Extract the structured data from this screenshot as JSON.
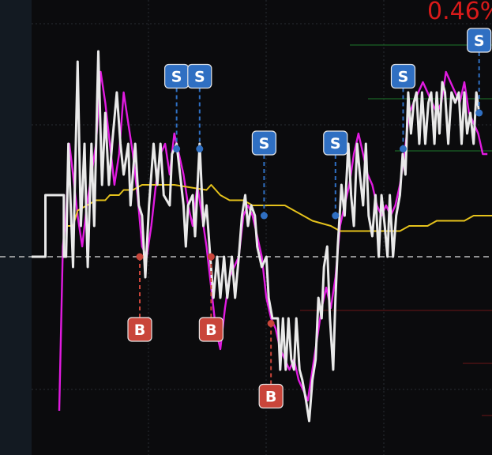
{
  "colors": {
    "background": "#0b0b0d",
    "left_panel": "#131a22",
    "grid": "#2a2d33",
    "price_line": "#e9e9e9",
    "magenta_line": "#e11be0",
    "avg_line": "#e5c21c",
    "baseline": "#bdbdbd",
    "buy": "#c9453a",
    "sell": "#2f6fc2",
    "percent_text": "#d91a1a"
  },
  "header": {
    "percent_label": "0.46%"
  },
  "chart_data": {
    "type": "line",
    "title": "",
    "xlabel": "",
    "ylabel": "",
    "x_range": [
      0,
      100
    ],
    "y_range": [
      0,
      100
    ],
    "baseline_y": 50,
    "series": [
      {
        "role": "price",
        "points": [
          [
            0,
            50
          ],
          [
            3,
            50
          ],
          [
            3,
            62
          ],
          [
            7,
            62
          ],
          [
            7,
            50
          ],
          [
            7.5,
            50
          ],
          [
            8,
            72
          ],
          [
            9,
            48
          ],
          [
            10,
            88
          ],
          [
            10.7,
            56
          ],
          [
            11.5,
            72
          ],
          [
            12.2,
            48
          ],
          [
            13,
            72
          ],
          [
            13.6,
            56
          ],
          [
            14.5,
            90
          ],
          [
            15.3,
            64
          ],
          [
            16,
            78
          ],
          [
            16.8,
            64
          ],
          [
            17.5,
            72
          ],
          [
            18.5,
            82
          ],
          [
            19.3,
            72
          ],
          [
            20,
            66
          ],
          [
            21,
            72
          ],
          [
            21.5,
            60
          ],
          [
            22.5,
            72
          ],
          [
            23.3,
            60
          ],
          [
            24,
            58
          ],
          [
            24.7,
            46
          ],
          [
            25.5,
            60
          ],
          [
            26.5,
            72
          ],
          [
            27.3,
            64
          ],
          [
            28,
            72
          ],
          [
            28.7,
            62
          ],
          [
            30,
            60
          ],
          [
            30.5,
            70
          ],
          [
            31.5,
            72
          ],
          [
            32,
            68
          ],
          [
            33,
            60
          ],
          [
            33.5,
            52
          ],
          [
            34,
            60
          ],
          [
            35,
            62
          ],
          [
            35.5,
            54
          ],
          [
            36.5,
            72
          ],
          [
            37.3,
            56
          ],
          [
            38,
            60
          ],
          [
            38.8,
            50
          ],
          [
            39.5,
            42
          ],
          [
            40.3,
            50
          ],
          [
            41,
            42
          ],
          [
            41.8,
            50
          ],
          [
            42.5,
            42
          ],
          [
            43.5,
            50
          ],
          [
            44.2,
            42
          ],
          [
            45,
            50
          ],
          [
            45.7,
            58
          ],
          [
            46.4,
            62
          ],
          [
            47,
            56
          ],
          [
            47.7,
            60
          ],
          [
            48.5,
            58
          ],
          [
            49,
            52
          ],
          [
            50,
            48
          ],
          [
            51,
            50
          ],
          [
            51.5,
            42
          ],
          [
            52.3,
            38
          ],
          [
            53.5,
            38
          ],
          [
            54,
            28
          ],
          [
            54.6,
            38
          ],
          [
            55.2,
            28
          ],
          [
            55.8,
            38
          ],
          [
            56.4,
            30
          ],
          [
            57,
            28
          ],
          [
            57.5,
            38
          ],
          [
            58.2,
            28
          ],
          [
            58.8,
            26
          ],
          [
            59.6,
            22
          ],
          [
            60.3,
            18
          ],
          [
            61,
            26
          ],
          [
            61.7,
            30
          ],
          [
            62.3,
            42
          ],
          [
            63,
            38
          ],
          [
            63.5,
            48
          ],
          [
            64.2,
            52
          ],
          [
            64.8,
            38
          ],
          [
            65.5,
            28
          ],
          [
            66,
            42
          ],
          [
            66.5,
            52
          ],
          [
            67.3,
            64
          ],
          [
            68,
            58
          ],
          [
            68.8,
            72
          ],
          [
            69.4,
            62
          ],
          [
            70,
            56
          ],
          [
            70.7,
            72
          ],
          [
            71.3,
            66
          ],
          [
            72,
            60
          ],
          [
            72.6,
            72
          ],
          [
            73.2,
            58
          ],
          [
            74,
            54
          ],
          [
            74.7,
            62
          ],
          [
            75.4,
            50
          ],
          [
            76,
            62
          ],
          [
            76.7,
            56
          ],
          [
            77.3,
            50
          ],
          [
            77.8,
            62
          ],
          [
            78.5,
            50
          ],
          [
            79.2,
            58
          ],
          [
            80,
            62
          ],
          [
            80.6,
            70
          ],
          [
            81.2,
            66
          ],
          [
            81.8,
            82
          ],
          [
            82.4,
            74
          ],
          [
            83,
            80
          ],
          [
            83.6,
            82
          ],
          [
            84.2,
            72
          ],
          [
            84.8,
            82
          ],
          [
            85.5,
            72
          ],
          [
            86.2,
            80
          ],
          [
            86.8,
            82
          ],
          [
            87.5,
            72
          ],
          [
            88,
            82
          ],
          [
            88.6,
            74
          ],
          [
            89.2,
            84
          ],
          [
            89.8,
            82
          ],
          [
            90.5,
            72
          ],
          [
            91.2,
            82
          ],
          [
            92,
            80
          ],
          [
            92.8,
            82
          ],
          [
            93.4,
            72
          ],
          [
            94,
            82
          ],
          [
            94.6,
            74
          ],
          [
            95.3,
            78
          ],
          [
            96,
            72
          ],
          [
            96.6,
            82
          ],
          [
            97.2,
            78
          ]
        ]
      },
      {
        "role": "magenta",
        "points": [
          [
            6,
            20
          ],
          [
            6.8,
            52
          ],
          [
            7.5,
            58
          ],
          [
            8.2,
            72
          ],
          [
            9,
            66
          ],
          [
            10,
            58
          ],
          [
            11,
            52
          ],
          [
            12,
            60
          ],
          [
            13,
            66
          ],
          [
            14,
            72
          ],
          [
            15,
            86
          ],
          [
            16,
            80
          ],
          [
            17,
            72
          ],
          [
            18,
            64
          ],
          [
            19,
            70
          ],
          [
            20,
            82
          ],
          [
            21,
            76
          ],
          [
            22,
            70
          ],
          [
            23,
            62
          ],
          [
            24,
            52
          ],
          [
            25,
            50
          ],
          [
            26,
            56
          ],
          [
            27,
            64
          ],
          [
            28,
            70
          ],
          [
            29,
            72
          ],
          [
            30,
            66
          ],
          [
            31,
            74
          ],
          [
            32,
            70
          ],
          [
            33,
            66
          ],
          [
            34,
            60
          ],
          [
            35,
            56
          ],
          [
            36,
            64
          ],
          [
            37,
            58
          ],
          [
            38,
            52
          ],
          [
            39,
            44
          ],
          [
            40,
            36
          ],
          [
            41,
            32
          ],
          [
            42,
            40
          ],
          [
            43,
            46
          ],
          [
            44,
            48
          ],
          [
            45,
            50
          ],
          [
            46,
            58
          ],
          [
            47,
            60
          ],
          [
            48,
            58
          ],
          [
            49,
            54
          ],
          [
            50,
            50
          ],
          [
            51,
            42
          ],
          [
            52,
            38
          ],
          [
            53,
            36
          ],
          [
            54,
            32
          ],
          [
            55,
            30
          ],
          [
            56,
            28
          ],
          [
            57,
            30
          ],
          [
            58,
            26
          ],
          [
            59,
            24
          ],
          [
            60,
            22
          ],
          [
            61,
            28
          ],
          [
            62,
            34
          ],
          [
            63,
            40
          ],
          [
            64,
            44
          ],
          [
            65,
            40
          ],
          [
            66,
            46
          ],
          [
            67,
            56
          ],
          [
            68,
            60
          ],
          [
            69,
            64
          ],
          [
            70,
            70
          ],
          [
            71,
            74
          ],
          [
            72,
            70
          ],
          [
            73,
            66
          ],
          [
            74,
            64
          ],
          [
            75,
            60
          ],
          [
            76,
            58
          ],
          [
            77,
            60
          ],
          [
            78,
            58
          ],
          [
            79,
            60
          ],
          [
            80,
            64
          ],
          [
            81,
            70
          ],
          [
            82,
            78
          ],
          [
            83,
            80
          ],
          [
            84,
            82
          ],
          [
            85,
            84
          ],
          [
            86,
            82
          ],
          [
            87,
            80
          ],
          [
            88,
            78
          ],
          [
            89,
            80
          ],
          [
            90,
            86
          ],
          [
            91,
            84
          ],
          [
            92,
            82
          ],
          [
            93,
            80
          ],
          [
            94,
            84
          ],
          [
            95,
            78
          ],
          [
            96,
            76
          ],
          [
            97,
            74
          ],
          [
            98,
            70
          ],
          [
            99,
            70
          ]
        ]
      },
      {
        "role": "average",
        "points": [
          [
            7.5,
            56
          ],
          [
            9,
            56
          ],
          [
            10,
            59
          ],
          [
            12,
            60
          ],
          [
            14,
            61
          ],
          [
            16,
            61
          ],
          [
            17,
            62
          ],
          [
            19,
            62
          ],
          [
            20,
            63
          ],
          [
            22,
            63
          ],
          [
            24,
            64
          ],
          [
            29,
            64
          ],
          [
            31,
            64
          ],
          [
            38,
            63
          ],
          [
            39,
            64
          ],
          [
            41,
            62
          ],
          [
            43,
            61
          ],
          [
            46,
            61
          ],
          [
            48,
            60
          ],
          [
            55,
            60
          ],
          [
            57,
            59
          ],
          [
            59,
            58
          ],
          [
            61,
            57
          ],
          [
            65,
            56
          ],
          [
            67,
            55
          ],
          [
            75,
            55
          ],
          [
            76,
            55
          ],
          [
            80,
            55
          ],
          [
            82,
            56
          ],
          [
            86,
            56
          ],
          [
            88,
            57
          ],
          [
            94,
            57
          ],
          [
            96,
            58
          ],
          [
            100,
            58
          ]
        ]
      }
    ],
    "buy_markers": [
      {
        "x": 23.5,
        "y": 50,
        "label": "B"
      },
      {
        "x": 39,
        "y": 50,
        "label": "B"
      },
      {
        "x": 52,
        "y": 37,
        "label": "B"
      }
    ],
    "sell_markers": [
      {
        "x": 31.5,
        "y": 71,
        "label": "S"
      },
      {
        "x": 36.5,
        "y": 71,
        "label": "S"
      },
      {
        "x": 50.5,
        "y": 58,
        "label": "S"
      },
      {
        "x": 66,
        "y": 58,
        "label": "S"
      },
      {
        "x": 80.7,
        "y": 71,
        "label": "S"
      },
      {
        "x": 97.2,
        "y": 78,
        "label": "S"
      }
    ]
  }
}
